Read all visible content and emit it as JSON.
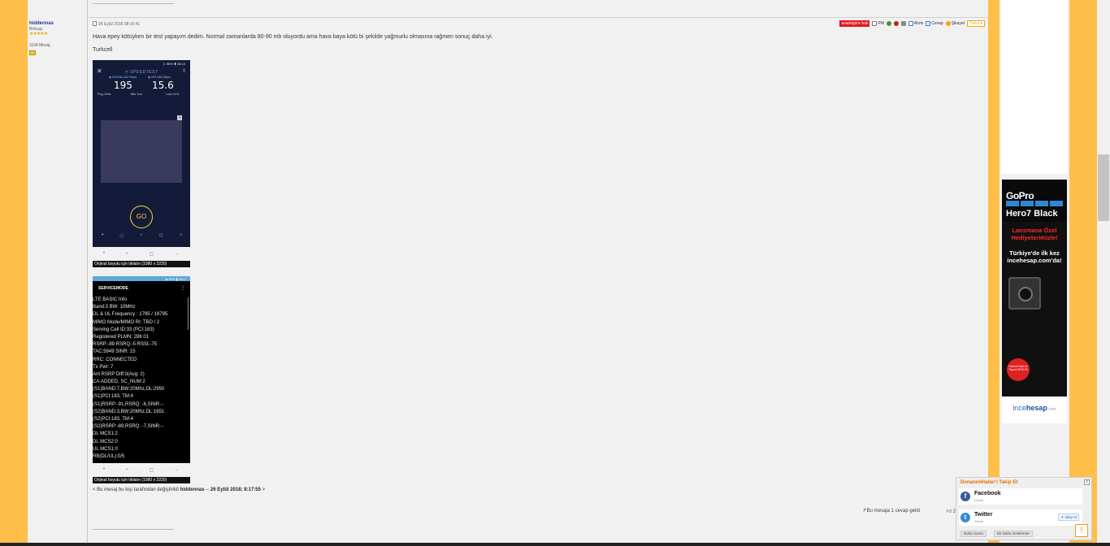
{
  "colors": {
    "page_bg": "#ffbf48",
    "panel_bg": "#f1f1f1",
    "accent_red": "#e3161a",
    "accent_orange": "#e8a81a",
    "link_blue": "#1a3d9a"
  },
  "user": {
    "name": "hiddennas",
    "rank": "Binbaşı",
    "stars": "★★★★★",
    "posts": "1104 Mesaj"
  },
  "post": {
    "date": "26 Eylül 2018 08:15:41",
    "avantaj": "avantajix'e bak",
    "actions": {
      "pm": "PM",
      "alinti": "Alıntı",
      "cevap": "Cevap",
      "sikayet": "Şikayet",
      "daha": "Daha"
    },
    "text": "Hava epey kötüyken bir test yapayım dedim. Normal zamanlarda 80-90 mb oluyordu ama hava baya kötü bi şekilde yağmurlu olmasına rağmen sonuç daha iyi.",
    "operator": "Turkcell"
  },
  "speedtest": {
    "status": "⎍ 96% ▮ 08:13",
    "title": "SPEEDTEST",
    "download_label": "DOWNLOAD Mbps",
    "upload_label": "UPLOAD Mbps",
    "download": "195",
    "upload": "15.6",
    "ping": "Ping 15ms",
    "jitter": "Jitter 1ms",
    "loss": "Loss 0.0%",
    "go": "GO"
  },
  "service": {
    "status": "◈ 95% ▮ 08:17",
    "title": "SERVICEMODE",
    "lines": [
      "LTE BASIC Info",
      "Band:3 BW: 10MHz",
      "DL & UL Frequency : 1795 / 19795",
      "MIMO Mode/MIMO RI: TBD / 2",
      "Serving Cell ID:33 (PCI:183)",
      "Registered PLMN: 286 01",
      "RSRP:-89 RSRQ:-5 RSSI:-75",
      "TAC:5949 SINR: 15",
      "RRC: CONNECTED",
      "Tx Pwr: 7",
      "Ant RSRP Diff:0(Avg: 2)",
      "CA:ADDED, SC_NUM:2",
      "(S1)BAND:7,BW:20Mhz,DL:2950",
      "(S1)PCI:183, TM:4",
      "(S1)RSRP:-91,RSRQ: -6,SINR:--",
      "(S2)BAND:3,BW:20Mhz,DL:1651",
      "(S2)PCI:183, TM:4",
      "(S2)RSRP:-89,RSRQ: -7,SINR:--",
      "DL MCS1:2",
      "DL MCS2:0",
      "UL MCS1:0",
      "RB(DL/UL):0/5"
    ]
  },
  "caption": "Orijinal boyutu için tıklatın (1080 x 2220)",
  "edit": {
    "prefix": "< Bu mesaj bu kişi tarafından değiştirildi ",
    "user": "hiddennas",
    "dash": " -- ",
    "date": "26 Eylül 2018; 8:17:55",
    "suffix": " >"
  },
  "reply_info": "Bu mesaja 1 cevap geldi",
  "likes": "2",
  "ad": {
    "brand": "GoPro",
    "model": "Hero7 Black",
    "promo": "Lansmana Özel Hediyelerimizle!",
    "first": "Türkiye'de ilk kez incehesap.com'da!",
    "badge": "Hafıza Kartı ve Tripod HEDİYE",
    "footer_a": "ince",
    "footer_b": "hesap",
    "footer_c": ".com"
  },
  "follow": {
    "title": "DonanımHaber'i Takip Et",
    "close": "x",
    "facebook": "Facebook",
    "facebook_sub": "Gözat",
    "twitter": "Twitter",
    "twitter_sub": "Gözat",
    "twitter_btn": "takip et",
    "later": "Daha Sonra",
    "never": "Bir Daha Gösterme!"
  }
}
